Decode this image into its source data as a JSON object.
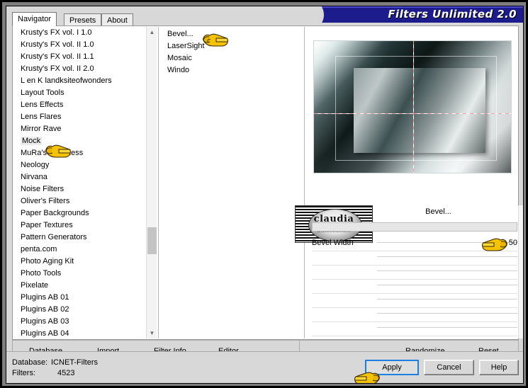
{
  "window": {
    "title": "Filters Unlimited 2.0",
    "title_color": "#1c1c8c"
  },
  "tabs": [
    {
      "label": "Navigator",
      "selected": true
    },
    {
      "label": "Presets",
      "selected": false
    },
    {
      "label": "About",
      "selected": false
    }
  ],
  "navigator": {
    "items": [
      {
        "label": "Krusty's FX vol. I 1.0"
      },
      {
        "label": "Krusty's FX vol. II 1.0"
      },
      {
        "label": "Krusty's FX vol. II 1.1"
      },
      {
        "label": "Krusty's FX vol. II 2.0"
      },
      {
        "label": "L en K landksiteofwonders"
      },
      {
        "label": "Layout Tools"
      },
      {
        "label": "Lens Effects"
      },
      {
        "label": "Lens Flares"
      },
      {
        "label": "Mirror Rave"
      },
      {
        "label": "Mock",
        "highlighted": true
      },
      {
        "label": "MuRa's Seamless"
      },
      {
        "label": "Neology"
      },
      {
        "label": "Nirvana"
      },
      {
        "label": "Noise Filters"
      },
      {
        "label": "Oliver's Filters"
      },
      {
        "label": "Paper Backgrounds"
      },
      {
        "label": "Paper Textures"
      },
      {
        "label": "Pattern Generators"
      },
      {
        "label": "penta.com"
      },
      {
        "label": "Photo Aging Kit"
      },
      {
        "label": "Photo Tools"
      },
      {
        "label": "Pixelate"
      },
      {
        "label": "Plugins AB 01"
      },
      {
        "label": "Plugins AB 02"
      },
      {
        "label": "Plugins AB 03"
      },
      {
        "label": "Plugins AB 04"
      }
    ]
  },
  "filters": {
    "items": [
      {
        "label": "Bevel...",
        "selected": true
      },
      {
        "label": "LaserSight",
        "selected": false
      },
      {
        "label": "Mosaic",
        "selected": false
      },
      {
        "label": "Windo",
        "selected": false
      }
    ]
  },
  "parameters": {
    "header": "Bevel...",
    "logo_name": "claudia",
    "logo_sub": "landksiteofwonders",
    "rows": [
      {
        "label": "Bevel Width",
        "value": "50"
      },
      {
        "label": "",
        "value": ""
      },
      {
        "label": "",
        "value": ""
      },
      {
        "label": "",
        "value": ""
      },
      {
        "label": "",
        "value": ""
      },
      {
        "label": "",
        "value": ""
      },
      {
        "label": "",
        "value": ""
      },
      {
        "label": "",
        "value": ""
      }
    ]
  },
  "actions": {
    "left": [
      {
        "label": "Database",
        "accel": "D"
      },
      {
        "label": "Import...",
        "accel": "m"
      },
      {
        "label": "Filter Info...",
        "accel": "I"
      },
      {
        "label": "Editor...",
        "accel": "E"
      }
    ],
    "right": [
      {
        "label": "Randomize"
      },
      {
        "label": "Reset"
      }
    ]
  },
  "status": {
    "database_label": "Database:",
    "database_value": "ICNET-Filters",
    "filters_label": "Filters:",
    "filters_value": "4523"
  },
  "buttons": {
    "apply": "Apply",
    "cancel": "Cancel",
    "help": "Help"
  }
}
